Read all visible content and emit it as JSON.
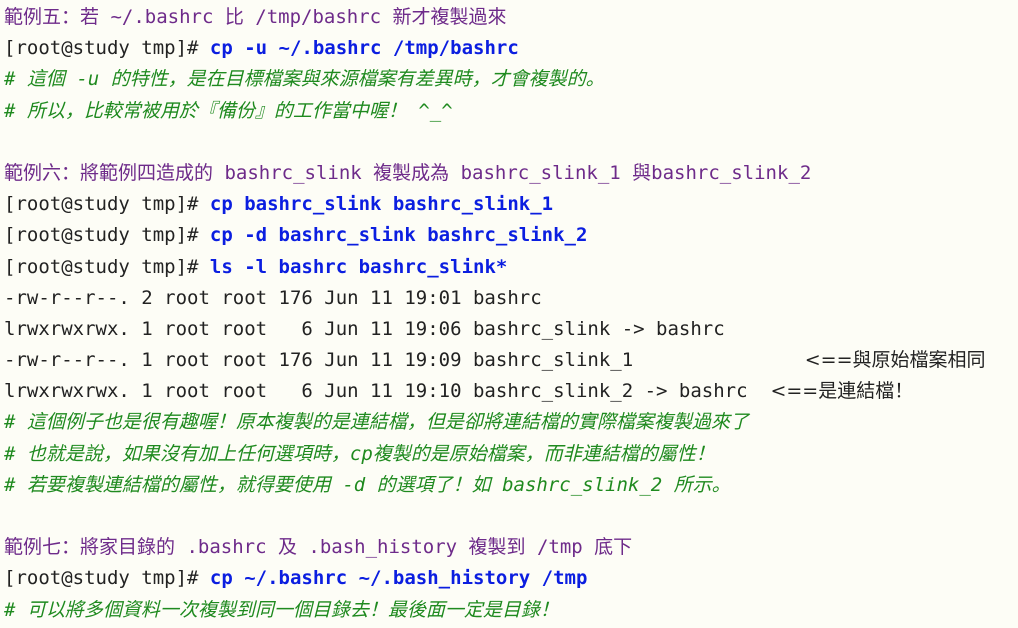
{
  "colors": {
    "background": "#fdfdf6",
    "title": "#6e2b8a",
    "prompt": "#222222",
    "command": "#0b1ee0",
    "comment": "#1f8a1f",
    "output": "#222222"
  },
  "lines": [
    {
      "type": "title",
      "text": "範例五：若 ~/.bashrc 比 /tmp/bashrc 新才複製過來"
    },
    {
      "type": "command",
      "prompt": "[root@study tmp]# ",
      "cmd": "cp -u ~/.bashrc /tmp/bashrc"
    },
    {
      "type": "comment",
      "text": "# 這個 -u 的特性，是在目標檔案與來源檔案有差異時，才會複製的。"
    },
    {
      "type": "comment",
      "text": "# 所以，比較常被用於『備份』的工作當中喔！ ^_^"
    },
    {
      "type": "blank"
    },
    {
      "type": "title",
      "text": "範例六：將範例四造成的 bashrc_slink 複製成為 bashrc_slink_1 與bashrc_slink_2"
    },
    {
      "type": "command",
      "prompt": "[root@study tmp]# ",
      "cmd": "cp bashrc_slink bashrc_slink_1"
    },
    {
      "type": "command",
      "prompt": "[root@study tmp]# ",
      "cmd": "cp -d bashrc_slink bashrc_slink_2"
    },
    {
      "type": "command",
      "prompt": "[root@study tmp]# ",
      "cmd": "ls -l bashrc bashrc_slink*"
    },
    {
      "type": "output",
      "text": "-rw-r--r--. 2 root root 176 Jun 11 19:01 bashrc"
    },
    {
      "type": "output",
      "text": "lrwxrwxrwx. 1 root root   6 Jun 11 19:06 bashrc_slink -> bashrc"
    },
    {
      "type": "output",
      "text": "-rw-r--r--. 1 root root 176 Jun 11 19:09 bashrc_slink_1",
      "note": "<==與原始檔案相同"
    },
    {
      "type": "output",
      "text": "lrwxrwxrwx. 1 root root   6 Jun 11 19:10 bashrc_slink_2 -> bashrc",
      "note": "<==是連結檔！"
    },
    {
      "type": "comment",
      "text": "# 這個例子也是很有趣喔！原本複製的是連結檔，但是卻將連結檔的實際檔案複製過來了"
    },
    {
      "type": "comment",
      "text": "# 也就是說，如果沒有加上任何選項時，cp複製的是原始檔案，而非連結檔的屬性！"
    },
    {
      "type": "comment",
      "text": "# 若要複製連結檔的屬性，就得要使用 -d 的選項了！如 bashrc_slink_2 所示。"
    },
    {
      "type": "blank"
    },
    {
      "type": "title",
      "text": "範例七：將家目錄的 .bashrc 及 .bash_history 複製到 /tmp 底下"
    },
    {
      "type": "command",
      "prompt": "[root@study tmp]# ",
      "cmd": "cp ~/.bashrc ~/.bash_history /tmp"
    },
    {
      "type": "comment",
      "text": "# 可以將多個資料一次複製到同一個目錄去！最後面一定是目錄！"
    }
  ]
}
